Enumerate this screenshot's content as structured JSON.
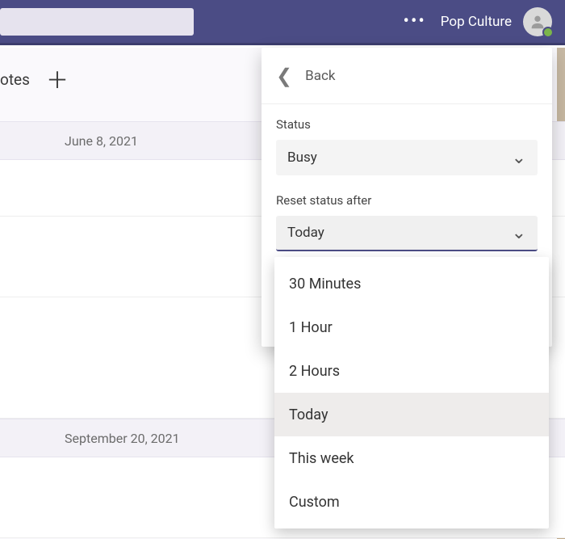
{
  "topbar": {
    "org_name": "Pop Culture"
  },
  "notes": {
    "header": "otes",
    "group1": "June 8, 2021",
    "group2": "September 20, 2021"
  },
  "panel": {
    "back_label": "Back",
    "status_label": "Status",
    "status_value": "Busy",
    "reset_label": "Reset status after",
    "reset_value": "Today"
  },
  "dropdown": {
    "options": [
      "30 Minutes",
      "1 Hour",
      "2 Hours",
      "Today",
      "This week",
      "Custom"
    ],
    "selected_index": 3
  }
}
